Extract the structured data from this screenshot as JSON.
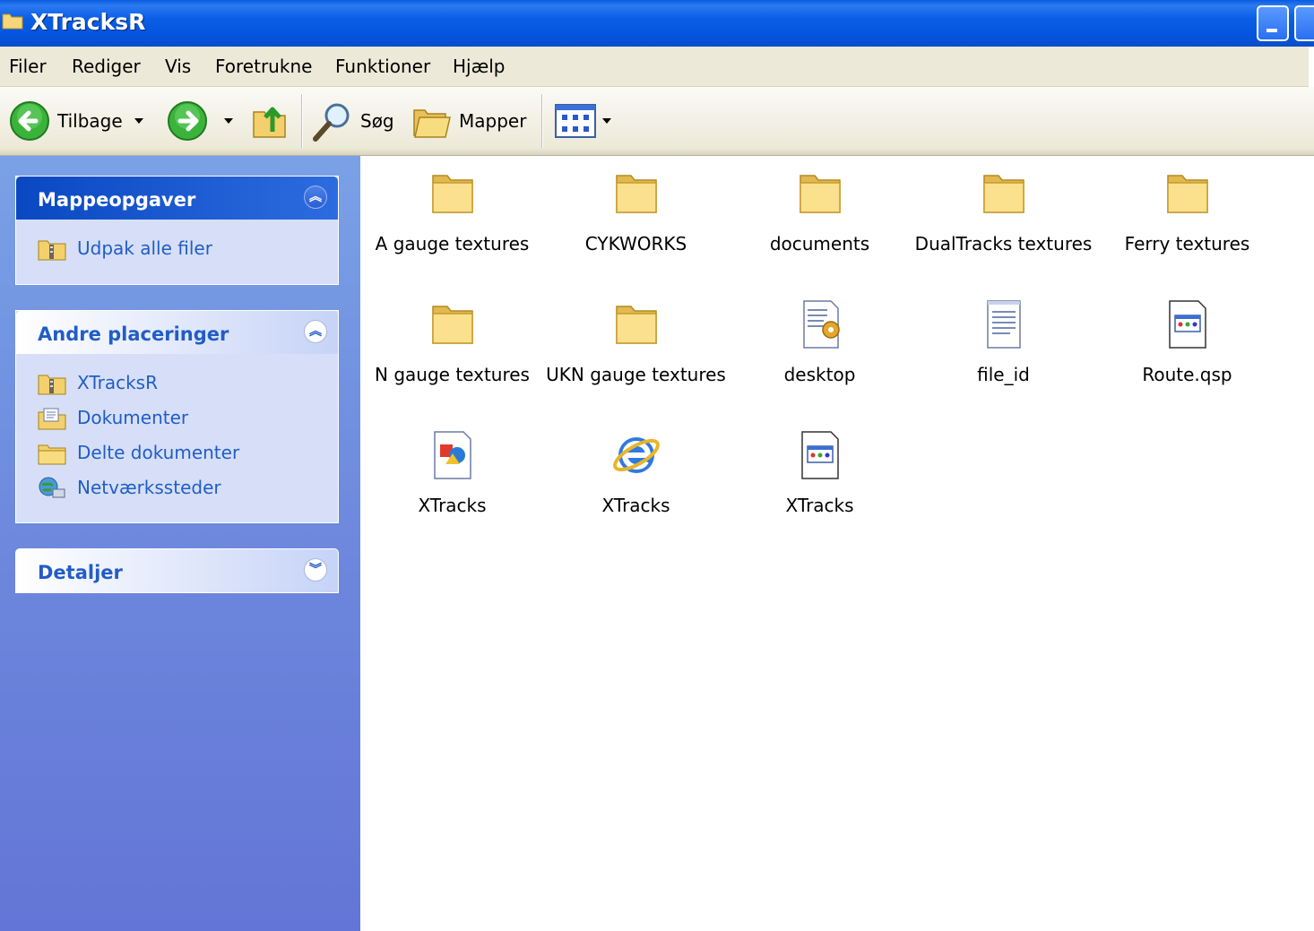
{
  "window": {
    "title": "XTracksR"
  },
  "menu": [
    "Filer",
    "Rediger",
    "Vis",
    "Foretrukne",
    "Funktioner",
    "Hjælp"
  ],
  "toolbar": {
    "back_label": "Tilbage",
    "search_label": "Søg",
    "folders_label": "Mapper"
  },
  "sidebar": {
    "tasks": {
      "title": "Mappeopgaver",
      "items": [
        {
          "label": "Udpak alle filer",
          "icon": "zip-folder-icon"
        }
      ]
    },
    "places": {
      "title": "Andre placeringer",
      "items": [
        {
          "label": "XTracksR",
          "icon": "zip-folder-icon"
        },
        {
          "label": "Dokumenter",
          "icon": "documents-icon"
        },
        {
          "label": "Delte dokumenter",
          "icon": "shared-folder-icon"
        },
        {
          "label": "Netværkssteder",
          "icon": "network-icon"
        }
      ]
    },
    "details": {
      "title": "Detaljer"
    }
  },
  "files": [
    {
      "name": "A gauge textures",
      "icon": "folder-icon"
    },
    {
      "name": "CYKWORKS",
      "icon": "folder-icon"
    },
    {
      "name": "documents",
      "icon": "folder-icon"
    },
    {
      "name": "DualTracks textures",
      "icon": "folder-icon"
    },
    {
      "name": "Ferry textures",
      "icon": "folder-icon"
    },
    {
      "name": "N gauge textures",
      "icon": "folder-icon"
    },
    {
      "name": "UKN gauge textures",
      "icon": "folder-icon"
    },
    {
      "name": "desktop",
      "icon": "config-file-icon"
    },
    {
      "name": "file_id",
      "icon": "text-file-icon"
    },
    {
      "name": "Route.qsp",
      "icon": "generic-file-icon"
    },
    {
      "name": "XTracks",
      "icon": "app-icon"
    },
    {
      "name": "XTracks",
      "icon": "internet-explorer-icon"
    },
    {
      "name": "XTracks",
      "icon": "generic-file-icon"
    }
  ]
}
